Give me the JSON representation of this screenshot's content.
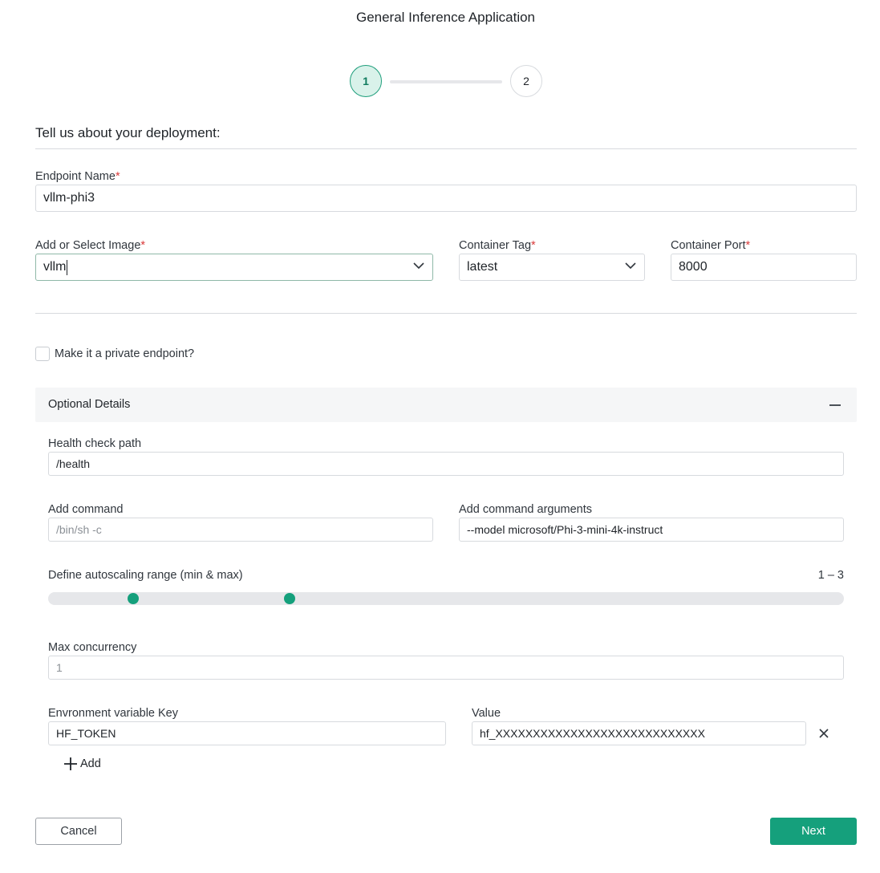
{
  "header": {
    "title": "General Inference Application"
  },
  "stepper": {
    "steps": [
      "1",
      "2"
    ],
    "current": 1
  },
  "deployment": {
    "heading": "Tell us about your deployment:",
    "required_mark": "*",
    "endpoint_name": {
      "label": "Endpoint Name",
      "value": "vllm-phi3"
    },
    "image": {
      "label": "Add or Select Image",
      "value": "vllm"
    },
    "container_tag": {
      "label": "Container Tag",
      "value": "latest"
    },
    "container_port": {
      "label": "Container Port",
      "value": "8000"
    }
  },
  "private_endpoint": {
    "label": "Make it a private endpoint?",
    "checked": false
  },
  "optional": {
    "title": "Optional Details",
    "health_check": {
      "label": "Health check path",
      "value": "/health"
    },
    "command": {
      "label": "Add command",
      "placeholder": "/bin/sh -c",
      "value": ""
    },
    "command_args": {
      "label": "Add command arguments",
      "value": "--model microsoft/Phi-3-mini-4k-instruct"
    },
    "autoscaling": {
      "label": "Define autoscaling range (min & max)",
      "range_text": "1 – 3",
      "min_fraction": 0.107,
      "max_fraction": 0.303
    },
    "max_concurrency": {
      "label": "Max concurrency",
      "placeholder": "1"
    },
    "env": {
      "key_label": "Envronment variable Key",
      "value_label": "Value",
      "rows": [
        {
          "key": "HF_TOKEN",
          "value": "hf_XXXXXXXXXXXXXXXXXXXXXXXXXXXX"
        }
      ],
      "add_label": "Add"
    }
  },
  "footer": {
    "cancel_label": "Cancel",
    "next_label": "Next"
  },
  "colors": {
    "accent": "#15a07c",
    "required": "#d93a3a",
    "step_active_bg": "#d9f2ea"
  },
  "icons": {
    "dropdown": "chevron-down-icon",
    "collapse": "minus-icon",
    "remove": "close-icon",
    "add": "plus-icon"
  }
}
